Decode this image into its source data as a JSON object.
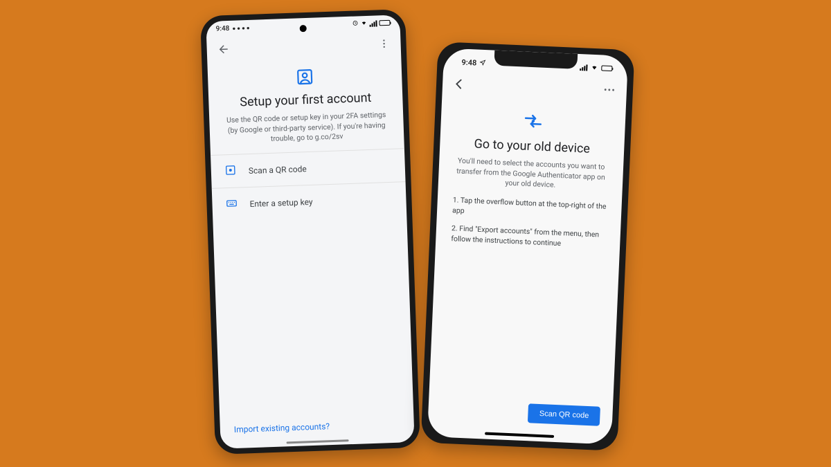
{
  "android": {
    "statusbar": {
      "time": "9:48"
    },
    "title": "Setup your first account",
    "subtitle": "Use the QR code or setup key in your 2FA settings (by Google or third-party service). If you're having trouble, go to g.co/2sv",
    "options": {
      "scan_qr": "Scan a QR code",
      "enter_key": "Enter a setup key"
    },
    "footer_link": "Import existing accounts?"
  },
  "ios": {
    "statusbar": {
      "time": "9:48"
    },
    "title": "Go to your old device",
    "subtitle": "You'll need to select the accounts you want to transfer from the Google Authenticator app on your old device.",
    "steps": {
      "step1": "1. Tap the overflow button at the top-right of the app",
      "step2": "2. Find \"Export accounts\" from the menu, then follow the instructions to continue"
    },
    "cta": "Scan QR code"
  },
  "colors": {
    "accent": "#1a73e8"
  }
}
